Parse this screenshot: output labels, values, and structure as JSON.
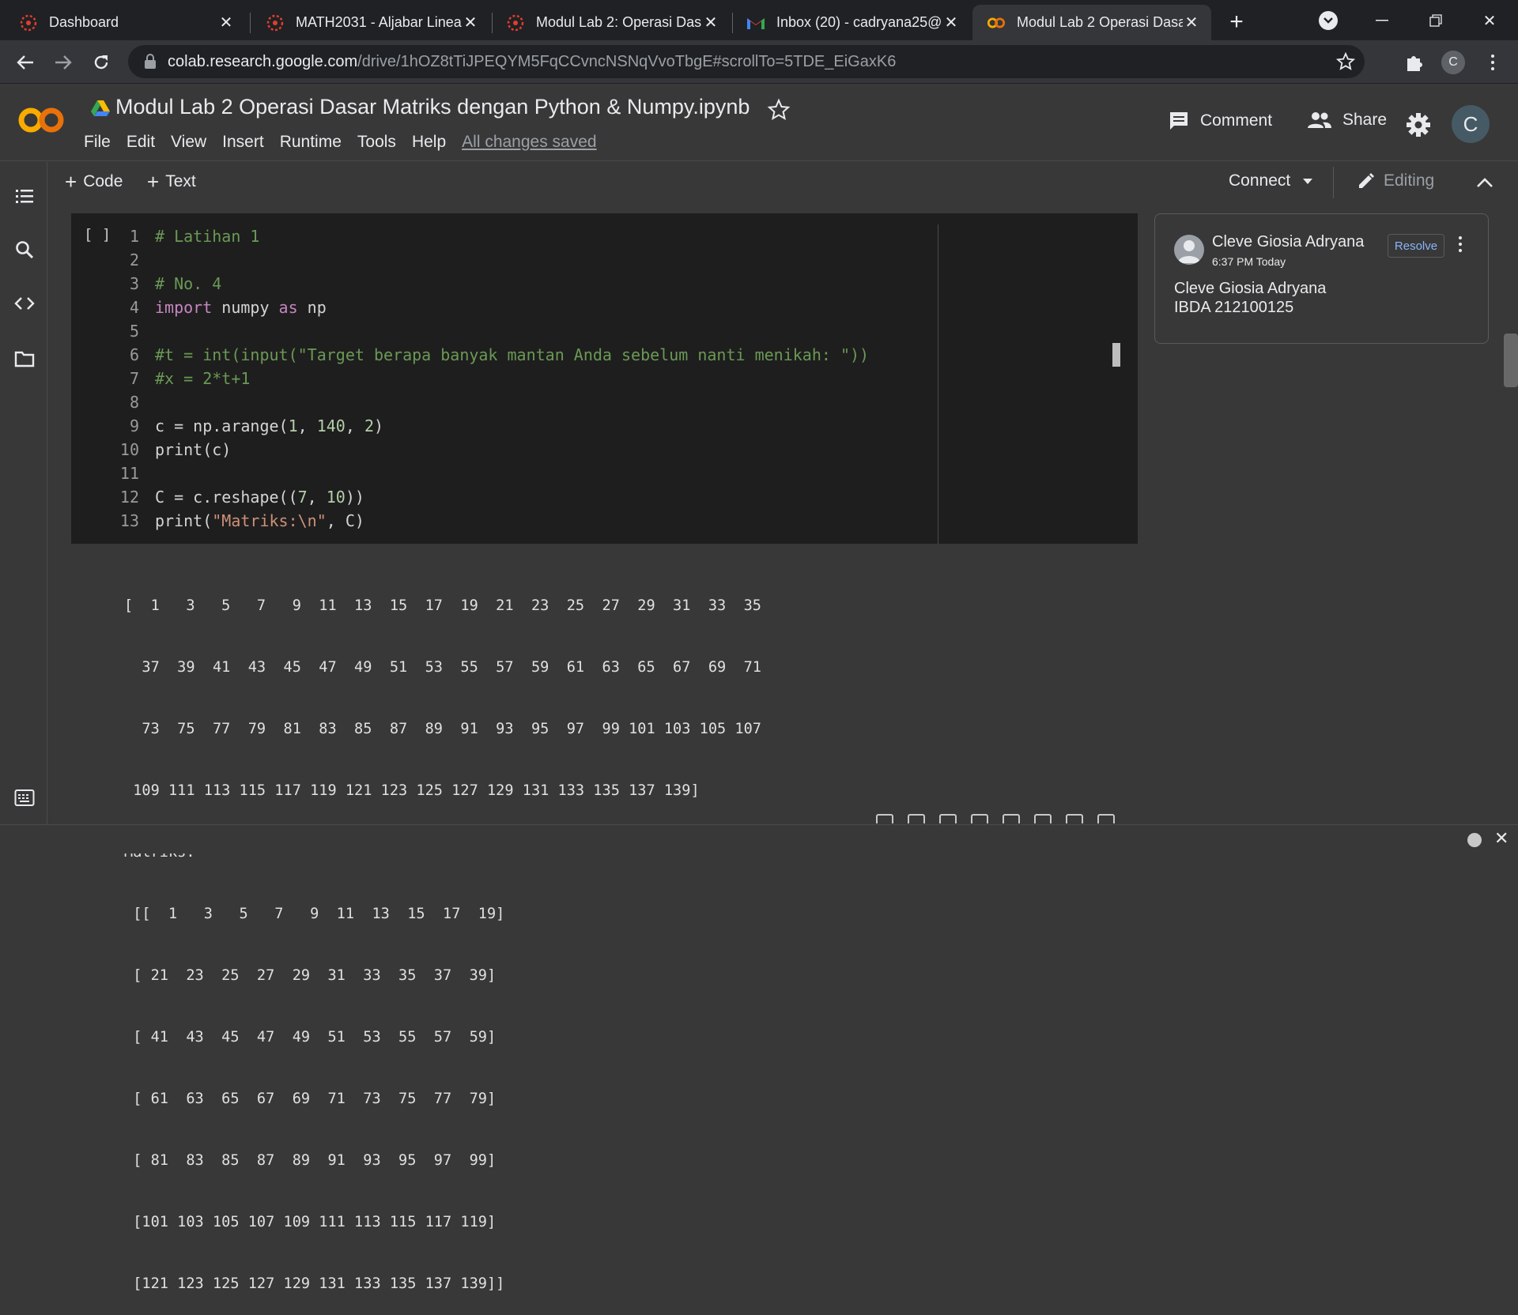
{
  "browser": {
    "tabs": [
      {
        "title": "Dashboard",
        "icon": "canvas-icon",
        "active": false
      },
      {
        "title": "MATH2031 - Aljabar Linea",
        "icon": "canvas-icon",
        "active": false
      },
      {
        "title": "Modul Lab 2: Operasi Das",
        "icon": "canvas-icon",
        "active": false
      },
      {
        "title": "Inbox (20) - cadryana25@",
        "icon": "gmail-icon",
        "active": false
      },
      {
        "title": "Modul Lab 2 Operasi Dasa",
        "icon": "colab-icon",
        "active": true
      }
    ],
    "url_host": "colab.research.google.com",
    "url_path": "/drive/1hOZ8tTiJPEQYM5FqCCvncNSNqVvoTbgE#scrollTo=5TDE_EiGaxK6",
    "profile_initial": "C"
  },
  "colab": {
    "notebook_title": "Modul Lab 2 Operasi Dasar Matriks dengan Python & Numpy.ipynb",
    "menu": [
      "File",
      "Edit",
      "View",
      "Insert",
      "Runtime",
      "Tools",
      "Help"
    ],
    "save_status": "All changes saved",
    "comment_label": "Comment",
    "share_label": "Share",
    "avatar_initial": "C",
    "add_code_label": "Code",
    "add_text_label": "Text",
    "connect_label": "Connect",
    "editing_label": "Editing"
  },
  "cell": {
    "run_indicator": "[ ]",
    "line_numbers": [
      "1",
      "2",
      "3",
      "4",
      "5",
      "6",
      "7",
      "8",
      "9",
      "10",
      "11",
      "12",
      "13"
    ],
    "lines": [
      "# Latihan 1",
      "",
      "# No. 4",
      "import numpy as np",
      "",
      "#t = int(input(\"Target berapa banyak mantan Anda sebelum nanti menikah: \"))",
      "#x = 2*t+1",
      "",
      "c = np.arange(1, 140, 2)",
      "print(c)",
      "",
      "C = c.reshape((7, 10))",
      "print(\"Matriks:\\n\", C)"
    ]
  },
  "output": {
    "lines": [
      "[  1   3   5   7   9  11  13  15  17  19  21  23  25  27  29  31  33  35",
      "  37  39  41  43  45  47  49  51  53  55  57  59  61  63  65  67  69  71",
      "  73  75  77  79  81  83  85  87  89  91  93  95  97  99 101 103 105 107",
      " 109 111 113 115 117 119 121 123 125 127 129 131 133 135 137 139]",
      "Matriks:",
      " [[  1   3   5   7   9  11  13  15  17  19]",
      " [ 21  23  25  27  29  31  33  35  37  39]",
      " [ 41  43  45  47  49  51  53  55  57  59]",
      " [ 61  63  65  67  69  71  73  75  77  79]",
      " [ 81  83  85  87  89  91  93  95  97  99]",
      " [101 103 105 107 109 111 113 115 117 119]",
      " [121 123 125 127 129 131 133 135 137 139]]"
    ]
  },
  "comment": {
    "author": "Cleve Giosia Adryana",
    "time": "6:37 PM Today",
    "resolve_label": "Resolve",
    "body_line1": "Cleve Giosia Adryana",
    "body_line2": "IBDA 212100125"
  },
  "colors": {
    "accent_orange": "#f9ab00",
    "link_blue": "#8ab4f8",
    "comment_green": "#6a9955",
    "keyword_purple": "#c586c0",
    "number_green": "#b5cea8",
    "string_orange": "#ce9178"
  }
}
